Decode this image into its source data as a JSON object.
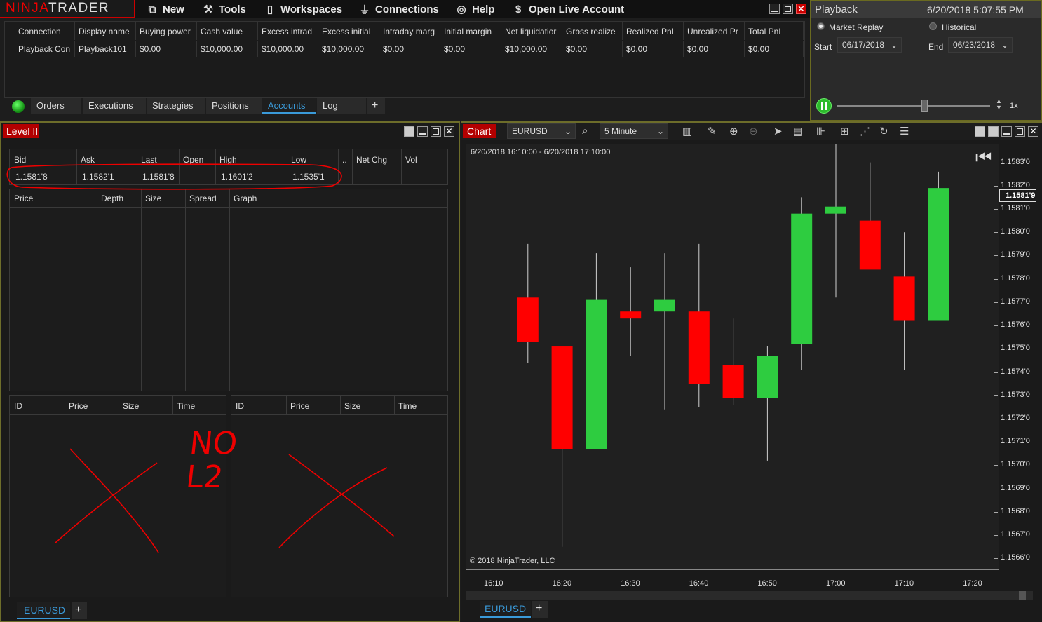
{
  "app": {
    "logo_left": "NINJA",
    "logo_right": "TRADER",
    "menu": [
      {
        "icon": "new-icon",
        "label": "New"
      },
      {
        "icon": "tools-icon",
        "label": "Tools"
      },
      {
        "icon": "workspaces-icon",
        "label": "Workspaces"
      },
      {
        "icon": "connections-icon",
        "label": "Connections"
      },
      {
        "icon": "help-icon",
        "label": "Help"
      },
      {
        "icon": "dollar-icon",
        "label": "Open Live Account"
      }
    ]
  },
  "accounts": {
    "headers": [
      "Connection",
      "Display name",
      "Buying power",
      "Cash value",
      "Excess intrad",
      "Excess initial",
      "Intraday marg",
      "Initial margin",
      "Net liquidatior",
      "Gross realize",
      "Realized PnL",
      "Unrealized Pr",
      "Total PnL"
    ],
    "row": [
      "Playback Con",
      "Playback101",
      "$0.00",
      "$10,000.00",
      "$10,000.00",
      "$10,000.00",
      "$0.00",
      "$0.00",
      "$10,000.00",
      "$0.00",
      "$0.00",
      "$0.00",
      "$0.00"
    ],
    "tabs": [
      "Orders",
      "Executions",
      "Strategies",
      "Positions",
      "Accounts",
      "Log"
    ],
    "active_tab": "Accounts",
    "add_tab": "+"
  },
  "playback": {
    "title": "Playback",
    "datetime": "6/20/2018 5:07:55 PM",
    "mode_market": "Market Replay",
    "mode_historical": "Historical",
    "start_label": "Start",
    "start_date": "06/17/2018",
    "end_label": "End",
    "end_date": "06/23/2018",
    "speed": "1x"
  },
  "level2": {
    "title": "Level II",
    "quote_headers": [
      "Bid",
      "Ask",
      "Last",
      "Open",
      "High",
      "Low",
      "..",
      "Net Chg",
      "Vol"
    ],
    "quote_values": [
      "1.1581'8",
      "1.1582'1",
      "1.1581'8",
      "",
      "1.1601'2",
      "1.1535'1",
      "",
      "",
      ""
    ],
    "depth_headers": [
      "Price",
      "Depth",
      "Size",
      "Spread",
      "Graph"
    ],
    "book_headers": [
      "ID",
      "Price",
      "Size",
      "Time"
    ],
    "annotation": [
      "NO",
      "L2"
    ],
    "tab": "EURUSD",
    "add_tab": "+"
  },
  "chart": {
    "title": "Chart",
    "instrument": "EURUSD",
    "interval": "5 Minute",
    "range": "6/20/2018 16:10:00 - 6/20/2018 17:10:00",
    "copyright": "© 2018 NinjaTrader, LLC",
    "last_price": "1.1581'9",
    "tab": "EURUSD",
    "add_tab": "+",
    "colors": {
      "up": "#2ecc40",
      "down": "#ff0000",
      "bg": "#202020"
    }
  },
  "chart_data": {
    "type": "candlestick",
    "x": [
      "16:15",
      "16:20",
      "16:25",
      "16:30",
      "16:35",
      "16:40",
      "16:45",
      "16:50",
      "16:55",
      "17:00",
      "17:05",
      "17:10",
      "17:15"
    ],
    "candles": [
      {
        "t": "16:15",
        "open": 1.15772,
        "high": 1.15795,
        "low": 1.15744,
        "close": 1.15753
      },
      {
        "t": "16:20",
        "open": 1.15751,
        "high": 1.15751,
        "low": 1.15665,
        "close": 1.15707
      },
      {
        "t": "16:25",
        "open": 1.15707,
        "high": 1.15791,
        "low": 1.15707,
        "close": 1.15771
      },
      {
        "t": "16:30",
        "open": 1.15766,
        "high": 1.15785,
        "low": 1.15747,
        "close": 1.15763
      },
      {
        "t": "16:35",
        "open": 1.15766,
        "high": 1.15791,
        "low": 1.15724,
        "close": 1.15771
      },
      {
        "t": "16:40",
        "open": 1.15766,
        "high": 1.15795,
        "low": 1.15725,
        "close": 1.15735
      },
      {
        "t": "16:45",
        "open": 1.15743,
        "high": 1.15763,
        "low": 1.15726,
        "close": 1.15729
      },
      {
        "t": "16:50",
        "open": 1.15729,
        "high": 1.15751,
        "low": 1.15702,
        "close": 1.15747
      },
      {
        "t": "16:55",
        "open": 1.15752,
        "high": 1.15815,
        "low": 1.15741,
        "close": 1.15808
      },
      {
        "t": "17:00",
        "open": 1.15808,
        "high": 1.15839,
        "low": 1.15772,
        "close": 1.15811
      },
      {
        "t": "17:05",
        "open": 1.15805,
        "high": 1.1583,
        "low": 1.1579,
        "close": 1.15784
      },
      {
        "t": "17:10",
        "open": 1.15781,
        "high": 1.158,
        "low": 1.15741,
        "close": 1.15762
      },
      {
        "t": "17:15",
        "open": 1.15762,
        "high": 1.15826,
        "low": 1.15762,
        "close": 1.15819
      }
    ],
    "y_ticks": [
      "1.1583'0",
      "1.1582'0",
      "1.1581'0",
      "1.1580'0",
      "1.1579'0",
      "1.1578'0",
      "1.1577'0",
      "1.1576'0",
      "1.1575'0",
      "1.1574'0",
      "1.1573'0",
      "1.1572'0",
      "1.1571'0",
      "1.1570'0",
      "1.1569'0",
      "1.1568'0",
      "1.1567'0",
      "1.1566'0"
    ],
    "x_ticks": [
      "16:10",
      "16:20",
      "16:30",
      "16:40",
      "16:50",
      "17:00",
      "17:10",
      "17:20"
    ],
    "ylim": [
      1.15655,
      1.15838
    ]
  }
}
